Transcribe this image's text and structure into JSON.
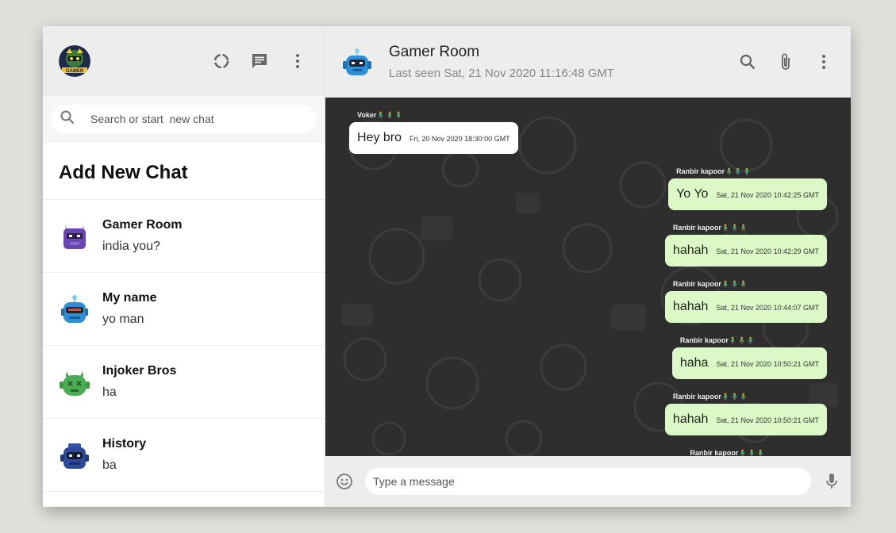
{
  "sidebar": {
    "search": {
      "placeholder": "Search or start  new chat"
    },
    "add_new_chat_label": "Add New Chat",
    "chats": [
      {
        "name": "Gamer Room",
        "last_message": "india you?",
        "avatar": "purple-robot-avatar"
      },
      {
        "name": "My name",
        "last_message": "yo man",
        "avatar": "blue-robot-avatar"
      },
      {
        "name": "Injoker Bros",
        "last_message": "ha",
        "avatar": "green-robot-avatar"
      },
      {
        "name": "History",
        "last_message": "ba",
        "avatar": "navy-robot-avatar"
      }
    ],
    "header_icons": [
      "status-icon",
      "new-chat-icon",
      "menu-icon"
    ]
  },
  "chat": {
    "title": "Gamer Room",
    "last_seen": "Last seen Sat, 21 Nov 2020 11:16:48 GMT",
    "header_icons": [
      "search-icon",
      "attach-icon",
      "menu-icon"
    ],
    "messages": [
      {
        "sender": "Voker🧍‍♂️🧍‍♂️🧍‍♂️",
        "text": "Hey bro",
        "time": "Fri, 20 Nov 2020 18:30:00 GMT",
        "side": "left"
      },
      {
        "sender": "Ranbir kapoor🧍‍♂️🧍‍♂️🧍‍♂️",
        "text": "Yo Yo",
        "time": "Sat, 21 Nov 2020 10:42:25 GMT",
        "side": "right"
      },
      {
        "sender": "Ranbir kapoor🧍‍♂️🧍‍♂️🧍‍♂️",
        "text": "hahah",
        "time": "Sat, 21 Nov 2020 10:42:29 GMT",
        "side": "right"
      },
      {
        "sender": "Ranbir kapoor🧍‍♂️🧍‍♂️🧍‍♂️",
        "text": "hahah",
        "time": "Sat, 21 Nov 2020 10:44:07 GMT",
        "side": "right"
      },
      {
        "sender": "Ranbir kapoor🧍‍♂️🧍‍♂️🧍‍♂️",
        "text": "haha",
        "time": "Sat, 21 Nov 2020 10:50:21 GMT",
        "side": "right"
      },
      {
        "sender": "Ranbir kapoor🧍‍♂️🧍‍♂️🧍‍♂️",
        "text": "hahah",
        "time": "Sat, 21 Nov 2020 10:50:21 GMT",
        "side": "right"
      },
      {
        "sender": "Ranbir kapoor🧍‍♂️🧍‍♂️🧍‍♂️",
        "text": "",
        "time": "",
        "side": "right"
      }
    ],
    "composer": {
      "placeholder": "Type a message"
    }
  },
  "colors": {
    "header_bg": "#ededed",
    "bubble_out": "#dcf8c6",
    "bubble_in": "#ffffff",
    "chat_bg": "#2b2b2b",
    "page_bg": "#dfe0da"
  }
}
